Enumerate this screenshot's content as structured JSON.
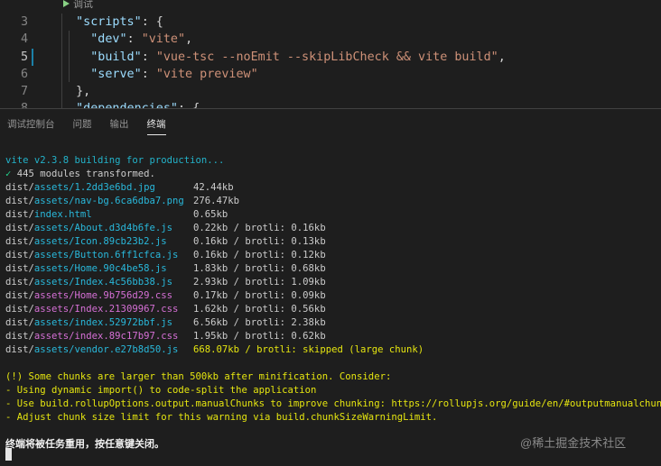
{
  "editor": {
    "codelens": "调试",
    "lines": [
      {
        "num": "3",
        "parts": [
          [
            "pun",
            "  "
          ],
          [
            "key",
            "\"scripts\""
          ],
          [
            "pun",
            ": {"
          ]
        ]
      },
      {
        "num": "4",
        "parts": [
          [
            "pun",
            "    "
          ],
          [
            "key",
            "\"dev\""
          ],
          [
            "pun",
            ": "
          ],
          [
            "str",
            "\"vite\""
          ],
          [
            "pun",
            ","
          ]
        ]
      },
      {
        "num": "5",
        "parts": [
          [
            "pun",
            "    "
          ],
          [
            "key",
            "\"build\""
          ],
          [
            "pun",
            ": "
          ],
          [
            "str",
            "\"vue-tsc --noEmit --skipLibCheck && vite build\""
          ],
          [
            "pun",
            ","
          ]
        ]
      },
      {
        "num": "6",
        "parts": [
          [
            "pun",
            "    "
          ],
          [
            "key",
            "\"serve\""
          ],
          [
            "pun",
            ": "
          ],
          [
            "str",
            "\"vite preview\""
          ]
        ]
      },
      {
        "num": "7",
        "parts": [
          [
            "pun",
            "  },"
          ]
        ]
      },
      {
        "num": "8",
        "parts": [
          [
            "pun",
            "  "
          ],
          [
            "key",
            "\"dependencies\""
          ],
          [
            "pun",
            ": {"
          ]
        ]
      }
    ]
  },
  "panel": {
    "tabs": [
      {
        "label": "调试控制台",
        "name": "tab-debug-console"
      },
      {
        "label": "问题",
        "name": "tab-problems"
      },
      {
        "label": "输出",
        "name": "tab-output"
      },
      {
        "label": "终端",
        "name": "tab-terminal"
      }
    ],
    "active_tab": 3
  },
  "terminal": {
    "building": "vite v2.3.8 building for production...",
    "check": "✓",
    "transformed": " 445 modules transformed.",
    "files": [
      {
        "dir": "dist/",
        "path": "assets/1.2dd3e6bd.jpg",
        "kind": "asset",
        "size": "42.44kb",
        "brotli": ""
      },
      {
        "dir": "dist/",
        "path": "assets/nav-bg.6ca6dba7.png",
        "kind": "asset",
        "size": "276.47kb",
        "brotli": ""
      },
      {
        "dir": "dist/",
        "path": "index.html",
        "kind": "asset",
        "size": "0.65kb",
        "brotli": ""
      },
      {
        "dir": "dist/",
        "path": "assets/About.d3d4b6fe.js",
        "kind": "asset",
        "size": "0.22kb",
        "brotli": " / brotli: 0.16kb"
      },
      {
        "dir": "dist/",
        "path": "assets/Icon.89cb23b2.js",
        "kind": "asset",
        "size": "0.16kb",
        "brotli": " / brotli: 0.13kb"
      },
      {
        "dir": "dist/",
        "path": "assets/Button.6ff1cfca.js",
        "kind": "asset",
        "size": "0.16kb",
        "brotli": " / brotli: 0.12kb"
      },
      {
        "dir": "dist/",
        "path": "assets/Home.90c4be58.js",
        "kind": "asset",
        "size": "1.83kb",
        "brotli": " / brotli: 0.68kb"
      },
      {
        "dir": "dist/",
        "path": "assets/Index.4c56bb38.js",
        "kind": "asset",
        "size": "2.93kb",
        "brotli": " / brotli: 1.09kb"
      },
      {
        "dir": "dist/",
        "path": "assets/Home.9b756d29.css",
        "kind": "css",
        "size": "0.17kb",
        "brotli": " / brotli: 0.09kb"
      },
      {
        "dir": "dist/",
        "path": "assets/Index.21309967.css",
        "kind": "css",
        "size": "1.62kb",
        "brotli": " / brotli: 0.56kb"
      },
      {
        "dir": "dist/",
        "path": "assets/index.52972bbf.js",
        "kind": "asset",
        "size": "6.56kb",
        "brotli": " / brotli: 2.38kb"
      },
      {
        "dir": "dist/",
        "path": "assets/index.89c17b97.css",
        "kind": "css",
        "size": "1.95kb",
        "brotli": " / brotli: 0.62kb"
      },
      {
        "dir": "dist/",
        "path": "assets/vendor.e27b8d50.js",
        "kind": "asset",
        "size": "668.07kb / brotli: skipped (large chunk)",
        "brotli": "",
        "warn": true
      }
    ],
    "warning_lines": [
      "(!) Some chunks are larger than 500kb after minification. Consider:",
      "- Using dynamic import() to code-split the application",
      "- Use build.rollupOptions.output.manualChunks to improve chunking: https://rollupjs.org/guide/en/#outputmanualchunks",
      "- Adjust chunk size limit for this warning via build.chunkSizeWarningLimit."
    ],
    "reuse_message": "终端将被任务重用，按任意键关闭。"
  },
  "watermark": "@稀土掘金技术社区",
  "colors": {
    "background": "#1e1e1e",
    "accent_cyan": "#23b2c9",
    "success_green": "#23d18b",
    "warning_yellow": "#e5e510",
    "css_magenta": "#d670d6"
  }
}
